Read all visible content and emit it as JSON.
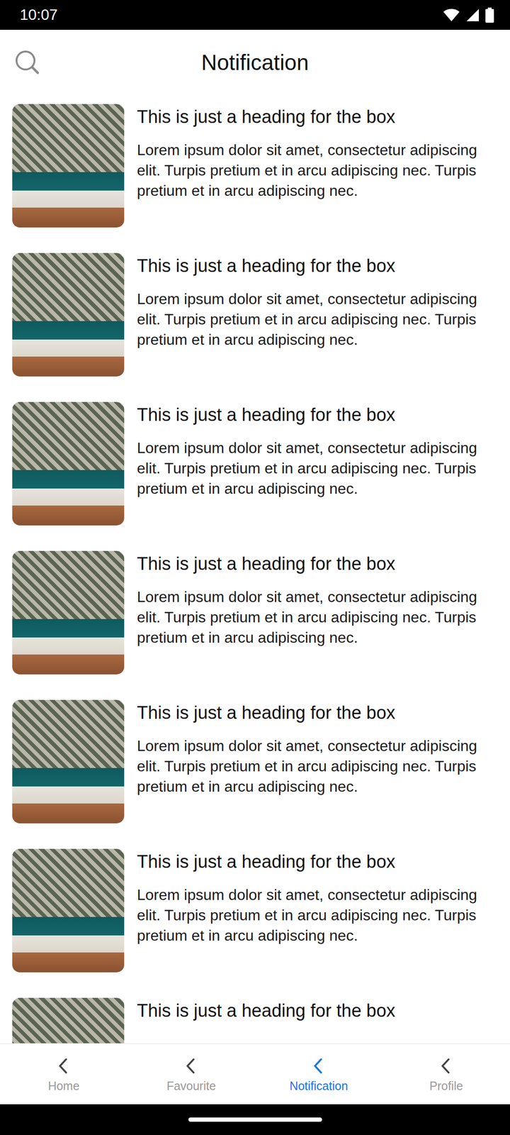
{
  "status_bar": {
    "time": "10:07"
  },
  "header": {
    "title": "Notification"
  },
  "notifications": [
    {
      "heading": "This is just a heading for the box",
      "body": "Lorem ipsum dolor sit amet, consectetur adipiscing elit. Turpis pretium et in arcu adipiscing nec. Turpis pretium et in arcu adipiscing nec."
    },
    {
      "heading": "This is just a heading for the box",
      "body": "Lorem ipsum dolor sit amet, consectetur adipiscing elit. Turpis pretium et in arcu adipiscing nec. Turpis pretium et in arcu adipiscing nec."
    },
    {
      "heading": "This is just a heading for the box",
      "body": "Lorem ipsum dolor sit amet, consectetur adipiscing elit. Turpis pretium et in arcu adipiscing nec. Turpis pretium et in arcu adipiscing nec."
    },
    {
      "heading": "This is just a heading for the box",
      "body": "Lorem ipsum dolor sit amet, consectetur adipiscing elit. Turpis pretium et in arcu adipiscing nec. Turpis pretium et in arcu adipiscing nec."
    },
    {
      "heading": "This is just a heading for the box",
      "body": "Lorem ipsum dolor sit amet, consectetur adipiscing elit. Turpis pretium et in arcu adipiscing nec. Turpis pretium et in arcu adipiscing nec."
    },
    {
      "heading": "This is just a heading for the box",
      "body": "Lorem ipsum dolor sit amet, consectetur adipiscing elit. Turpis pretium et in arcu adipiscing nec. Turpis pretium et in arcu adipiscing nec."
    },
    {
      "heading": "This is just a heading for the box",
      "body": ""
    }
  ],
  "bottom_nav": [
    {
      "label": "Home",
      "selected": false
    },
    {
      "label": "Favourite",
      "selected": false
    },
    {
      "label": "Notification",
      "selected": true
    },
    {
      "label": "Profile",
      "selected": false
    }
  ]
}
